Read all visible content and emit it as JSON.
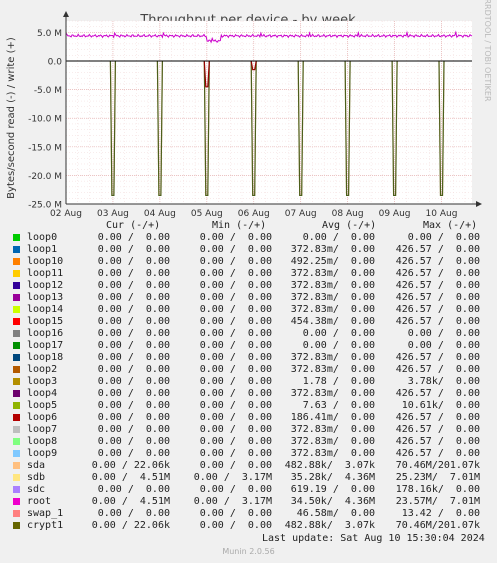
{
  "chart_data": {
    "type": "line",
    "title": "Throughput per device - by week",
    "ylabel": "Bytes/second read (-) / write (+)",
    "watermark": "RRDTOOL / TOBI OETIKER",
    "ylim": [
      -25000000,
      7000000
    ],
    "y_ticks": [
      5000000,
      0,
      -5000000,
      -10000000,
      -15000000,
      -20000000,
      -25000000
    ],
    "y_tick_labels": [
      "5.0 M",
      "0.0",
      "-5.0 M",
      "-10.0 M",
      "-15.0 M",
      "-20.0 M",
      "-25.0 M"
    ],
    "x_tick_labels": [
      "02 Aug",
      "03 Aug",
      "04 Aug",
      "05 Aug",
      "06 Aug",
      "07 Aug",
      "08 Aug",
      "09 Aug",
      "10 Aug"
    ],
    "x_range_days": [
      0,
      8.65
    ],
    "grid": true,
    "series": [
      {
        "name": "root",
        "color": "#cc00cc",
        "kind": "write_noise",
        "baseline": 4400000
      },
      {
        "name": "sda",
        "color": "#e6c08c",
        "kind": "read_spikes",
        "spikes": [
          {
            "x": 1.0,
            "y": -23500000
          },
          {
            "x": 2.0,
            "y": -23500000
          },
          {
            "x": 3.0,
            "y": -23500000
          },
          {
            "x": 4.0,
            "y": -23500000
          },
          {
            "x": 5.0,
            "y": -23500000
          },
          {
            "x": 6.0,
            "y": -23500000
          },
          {
            "x": 7.0,
            "y": -23500000
          },
          {
            "x": 8.0,
            "y": -23500000
          }
        ]
      },
      {
        "name": "crypt1",
        "color": "#4d5f1c",
        "kind": "read_spikes",
        "spikes": [
          {
            "x": 1.0,
            "y": -23500000
          },
          {
            "x": 2.0,
            "y": -23500000
          },
          {
            "x": 3.0,
            "y": -23500000
          },
          {
            "x": 4.0,
            "y": -23500000
          },
          {
            "x": 5.0,
            "y": -23500000
          },
          {
            "x": 6.0,
            "y": -23500000
          },
          {
            "x": 7.0,
            "y": -23500000
          },
          {
            "x": 8.0,
            "y": -23500000
          }
        ]
      },
      {
        "name": "loop6",
        "color": "#990000",
        "kind": "read_spikes",
        "spikes": [
          {
            "x": 3.0,
            "y": -4500000
          },
          {
            "x": 4.0,
            "y": -1500000
          }
        ]
      }
    ]
  },
  "legend": {
    "headers": {
      "cur": "Cur (-/+)",
      "min": "Min (-/+)",
      "avg": "Avg (-/+)",
      "max": "Max (-/+)"
    },
    "rows": [
      {
        "name": "loop0",
        "color": "#00cc00",
        "cur": "0.00 /  0.00",
        "min": "0.00 /  0.00",
        "avg": "0.00 /  0.00",
        "max": "0.00 /  0.00"
      },
      {
        "name": "loop1",
        "color": "#0066b3",
        "cur": "0.00 /  0.00",
        "min": "0.00 /  0.00",
        "avg": "372.83m/  0.00",
        "max": "426.57 /  0.00"
      },
      {
        "name": "loop10",
        "color": "#ff8000",
        "cur": "0.00 /  0.00",
        "min": "0.00 /  0.00",
        "avg": "492.25m/  0.00",
        "max": "426.57 /  0.00"
      },
      {
        "name": "loop11",
        "color": "#ffcc00",
        "cur": "0.00 /  0.00",
        "min": "0.00 /  0.00",
        "avg": "372.83m/  0.00",
        "max": "426.57 /  0.00"
      },
      {
        "name": "loop12",
        "color": "#330099",
        "cur": "0.00 /  0.00",
        "min": "0.00 /  0.00",
        "avg": "372.83m/  0.00",
        "max": "426.57 /  0.00"
      },
      {
        "name": "loop13",
        "color": "#990099",
        "cur": "0.00 /  0.00",
        "min": "0.00 /  0.00",
        "avg": "372.83m/  0.00",
        "max": "426.57 /  0.00"
      },
      {
        "name": "loop14",
        "color": "#ccff00",
        "cur": "0.00 /  0.00",
        "min": "0.00 /  0.00",
        "avg": "372.83m/  0.00",
        "max": "426.57 /  0.00"
      },
      {
        "name": "loop15",
        "color": "#ff0000",
        "cur": "0.00 /  0.00",
        "min": "0.00 /  0.00",
        "avg": "454.38m/  0.00",
        "max": "426.57 /  0.00"
      },
      {
        "name": "loop16",
        "color": "#808080",
        "cur": "0.00 /  0.00",
        "min": "0.00 /  0.00",
        "avg": "0.00 /  0.00",
        "max": "0.00 /  0.00"
      },
      {
        "name": "loop17",
        "color": "#008f00",
        "cur": "0.00 /  0.00",
        "min": "0.00 /  0.00",
        "avg": "0.00 /  0.00",
        "max": "0.00 /  0.00"
      },
      {
        "name": "loop18",
        "color": "#00487d",
        "cur": "0.00 /  0.00",
        "min": "0.00 /  0.00",
        "avg": "372.83m/  0.00",
        "max": "426.57 /  0.00"
      },
      {
        "name": "loop2",
        "color": "#b35a00",
        "cur": "0.00 /  0.00",
        "min": "0.00 /  0.00",
        "avg": "372.83m/  0.00",
        "max": "426.57 /  0.00"
      },
      {
        "name": "loop3",
        "color": "#b38f00",
        "cur": "0.00 /  0.00",
        "min": "0.00 /  0.00",
        "avg": "1.78 /  0.00",
        "max": "3.78k/  0.00"
      },
      {
        "name": "loop4",
        "color": "#6b006b",
        "cur": "0.00 /  0.00",
        "min": "0.00 /  0.00",
        "avg": "372.83m/  0.00",
        "max": "426.57 /  0.00"
      },
      {
        "name": "loop5",
        "color": "#8fb300",
        "cur": "0.00 /  0.00",
        "min": "0.00 /  0.00",
        "avg": "7.63 /  0.00",
        "max": "10.61k/  0.00"
      },
      {
        "name": "loop6",
        "color": "#b30000",
        "cur": "0.00 /  0.00",
        "min": "0.00 /  0.00",
        "avg": "186.41m/  0.00",
        "max": "426.57 /  0.00"
      },
      {
        "name": "loop7",
        "color": "#bebebe",
        "cur": "0.00 /  0.00",
        "min": "0.00 /  0.00",
        "avg": "372.83m/  0.00",
        "max": "426.57 /  0.00"
      },
      {
        "name": "loop8",
        "color": "#80ff80",
        "cur": "0.00 /  0.00",
        "min": "0.00 /  0.00",
        "avg": "372.83m/  0.00",
        "max": "426.57 /  0.00"
      },
      {
        "name": "loop9",
        "color": "#80c9ff",
        "cur": "0.00 /  0.00",
        "min": "0.00 /  0.00",
        "avg": "372.83m/  0.00",
        "max": "426.57 /  0.00"
      },
      {
        "name": "sda",
        "color": "#ffc080",
        "cur": "0.00 / 22.06k",
        "min": "0.00 /  0.00",
        "avg": "482.88k/  3.07k",
        "max": "70.46M/201.07k"
      },
      {
        "name": "sdb",
        "color": "#ffe680",
        "cur": "0.00 /  4.51M",
        "min": "0.00 /  3.17M",
        "avg": "35.28k/  4.36M",
        "max": "25.23M/  7.01M"
      },
      {
        "name": "sdc",
        "color": "#aa80ff",
        "cur": "0.00 /  0.00",
        "min": "0.00 /  0.00",
        "avg": "619.19 /  0.00",
        "max": "178.16k/  0.00"
      },
      {
        "name": "root",
        "color": "#ee00cc",
        "cur": "0.00 /  4.51M",
        "min": "0.00 /  3.17M",
        "avg": "34.50k/  4.36M",
        "max": "23.57M/  7.01M"
      },
      {
        "name": "swap_1",
        "color": "#ff8080",
        "cur": "0.00 /  0.00",
        "min": "0.00 /  0.00",
        "avg": "46.58m/  0.00",
        "max": "13.42 /  0.00"
      },
      {
        "name": "crypt1",
        "color": "#666600",
        "cur": "0.00 / 22.06k",
        "min": "0.00 /  0.00",
        "avg": "482.88k/  3.07k",
        "max": "70.46M/201.07k"
      }
    ]
  },
  "footer": {
    "last_update": "Last update: Sat Aug 10 15:30:04 2024",
    "version": "Munin 2.0.56"
  }
}
